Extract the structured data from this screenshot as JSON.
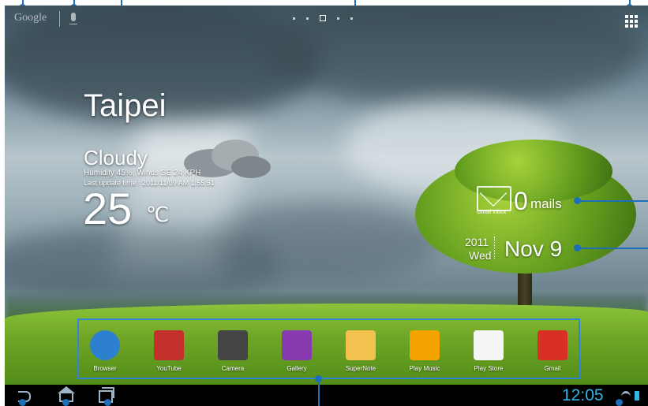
{
  "top_bar": {
    "search_logo": "Google",
    "page_indicator_count": 5,
    "page_indicator_active": 3
  },
  "weather": {
    "city": "Taipei",
    "condition": "Cloudy",
    "details": "Humidity 45%, Winds SE 24 KPH",
    "last_update": "Last update time : 2011/11/09 AM 1:55:51",
    "temperature": "25",
    "unit": "℃"
  },
  "mail": {
    "count": "0",
    "word": "mails",
    "inbox_label": "Gmail Inbox"
  },
  "date": {
    "year": "2011",
    "weekday": "Wed",
    "date": "Nov 9"
  },
  "dock": {
    "apps": [
      {
        "label": "Browser",
        "icon": "globe-icon",
        "color": "#2d7fd0"
      },
      {
        "label": "YouTube",
        "icon": "youtube-icon",
        "color": "#c4302b"
      },
      {
        "label": "Camera",
        "icon": "camera-icon",
        "color": "#444444"
      },
      {
        "label": "Gallery",
        "icon": "gallery-icon",
        "color": "#8a3ab0"
      },
      {
        "label": "SuperNote",
        "icon": "notebook-icon",
        "color": "#f2c14e"
      },
      {
        "label": "Play Music",
        "icon": "headphones-icon",
        "color": "#f4a300"
      },
      {
        "label": "Play Store",
        "icon": "shopping-bag-icon",
        "color": "#f5f5f5"
      },
      {
        "label": "Gmail",
        "icon": "gmail-icon",
        "color": "#d93025"
      }
    ]
  },
  "status_bar": {
    "time": "12:05"
  },
  "colors": {
    "accent": "#33b5e5",
    "callout": "#1f6fb8"
  }
}
